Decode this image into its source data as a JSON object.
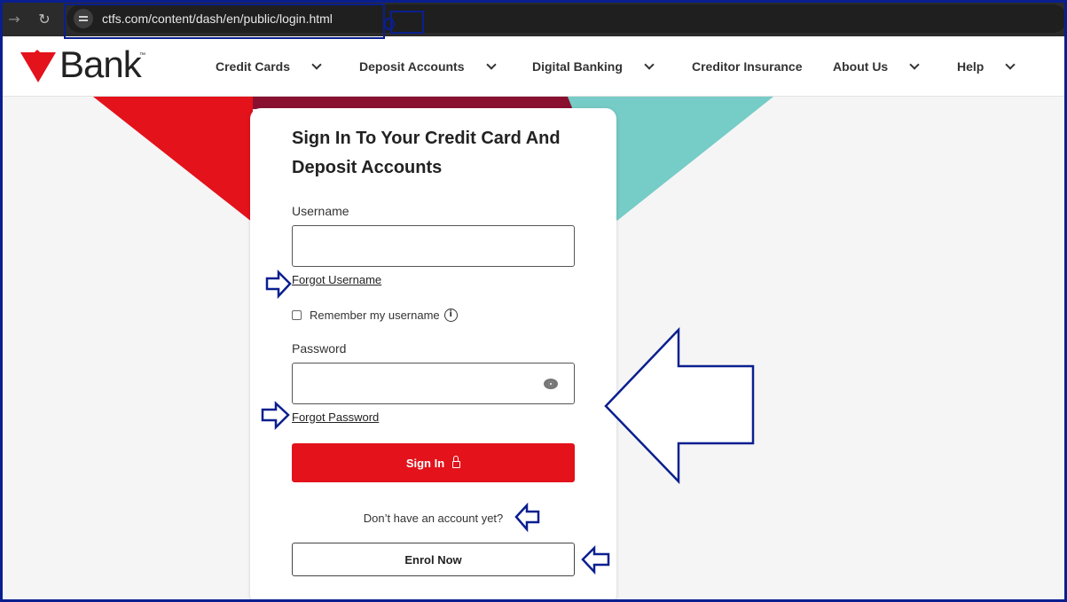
{
  "browser": {
    "url": "ctfs.com/content/dash/en/public/login.html",
    "forward_icon": "→",
    "reload_icon": "↻",
    "site_info_icon": "tune-icon"
  },
  "header": {
    "logo_text": "Bank",
    "logo_tm": "™",
    "nav": [
      {
        "label": "Credit Cards",
        "has_dropdown": true
      },
      {
        "label": "Deposit Accounts",
        "has_dropdown": true
      },
      {
        "label": "Digital Banking",
        "has_dropdown": true
      },
      {
        "label": "Creditor Insurance",
        "has_dropdown": false
      },
      {
        "label": "About Us",
        "has_dropdown": true
      },
      {
        "label": "Help",
        "has_dropdown": true
      }
    ]
  },
  "login": {
    "title": "Sign In To Your Credit Card And Deposit Accounts",
    "username_label": "Username",
    "username_value": "",
    "forgot_username": "Forgot Username",
    "remember_label": "Remember my username",
    "remember_checked": false,
    "info_icon": "i",
    "password_label": "Password",
    "password_value": "",
    "forgot_password": "Forgot Password",
    "signin_label": "Sign In",
    "no_account_text": "Don’t have an account yet?",
    "enrol_label": "Enrol Now"
  },
  "colors": {
    "brand_red": "#e3121b",
    "teal": "#76ccc6",
    "dark_red": "#8a1030",
    "annotation_blue": "#0a1f8f"
  }
}
